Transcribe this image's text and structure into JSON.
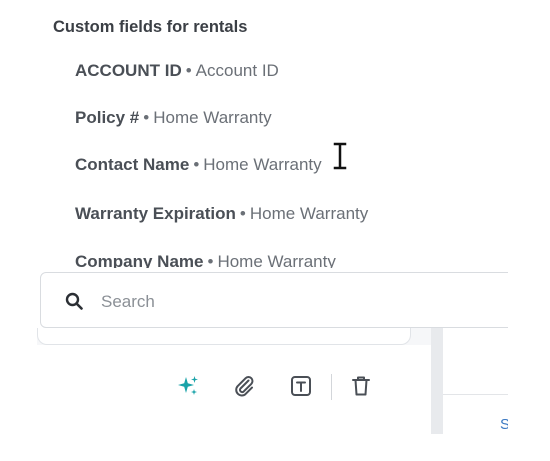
{
  "custom_fields": {
    "group_heading": "Custom fields for rentals",
    "items": [
      {
        "name": "ACCOUNT ID",
        "separator": "•",
        "source": "Account ID"
      },
      {
        "name": "Policy #",
        "separator": "•",
        "source": "Home Warranty"
      },
      {
        "name": "Contact Name",
        "separator": "•",
        "source": "Home Warranty"
      },
      {
        "name": "Warranty Expiration",
        "separator": "•",
        "source": "Home Warranty"
      },
      {
        "name": "Company Name",
        "separator": "•",
        "source": "Home Warranty"
      }
    ]
  },
  "search": {
    "placeholder": "Search",
    "value": "",
    "icon": "search-icon"
  },
  "toolbar": {
    "icons": [
      "sparkle-icon",
      "paperclip-icon",
      "text-format-icon",
      "trash-icon"
    ],
    "ai_accent_color": "#1aa3a9",
    "icon_color": "#4a4f56"
  },
  "right_pane": {
    "link_fragment": "S"
  }
}
